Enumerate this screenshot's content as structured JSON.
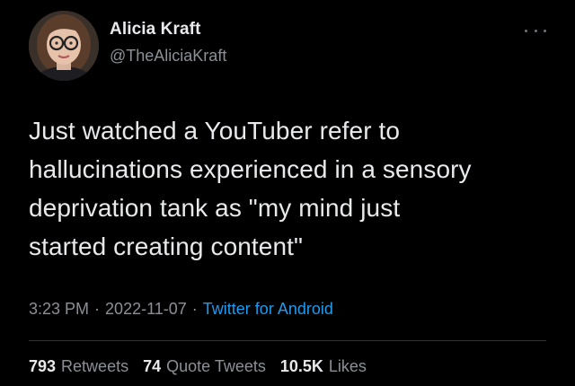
{
  "tweet": {
    "author": {
      "display_name": "Alicia Kraft",
      "handle": "@TheAliciaKraft"
    },
    "text": "Just watched a YouTuber refer to\nhallucinations experienced in a sensory\ndeprivation tank as \"my mind just\nstarted creating content\"",
    "time": "3:23 PM",
    "separator": "·",
    "date": "2022-11-07",
    "source": "Twitter for Android",
    "stats": {
      "retweets_count": "793",
      "retweets_label": "Retweets",
      "quotes_count": "74",
      "quotes_label": "Quote Tweets",
      "likes_count": "10.5K",
      "likes_label": "Likes"
    }
  },
  "colors": {
    "background": "#000000",
    "primary_text": "#e7e9ea",
    "secondary_text": "#8b9096",
    "link": "#1d9bf0",
    "divider": "#2f3336"
  },
  "icons": {
    "more": "more-dots-icon"
  }
}
